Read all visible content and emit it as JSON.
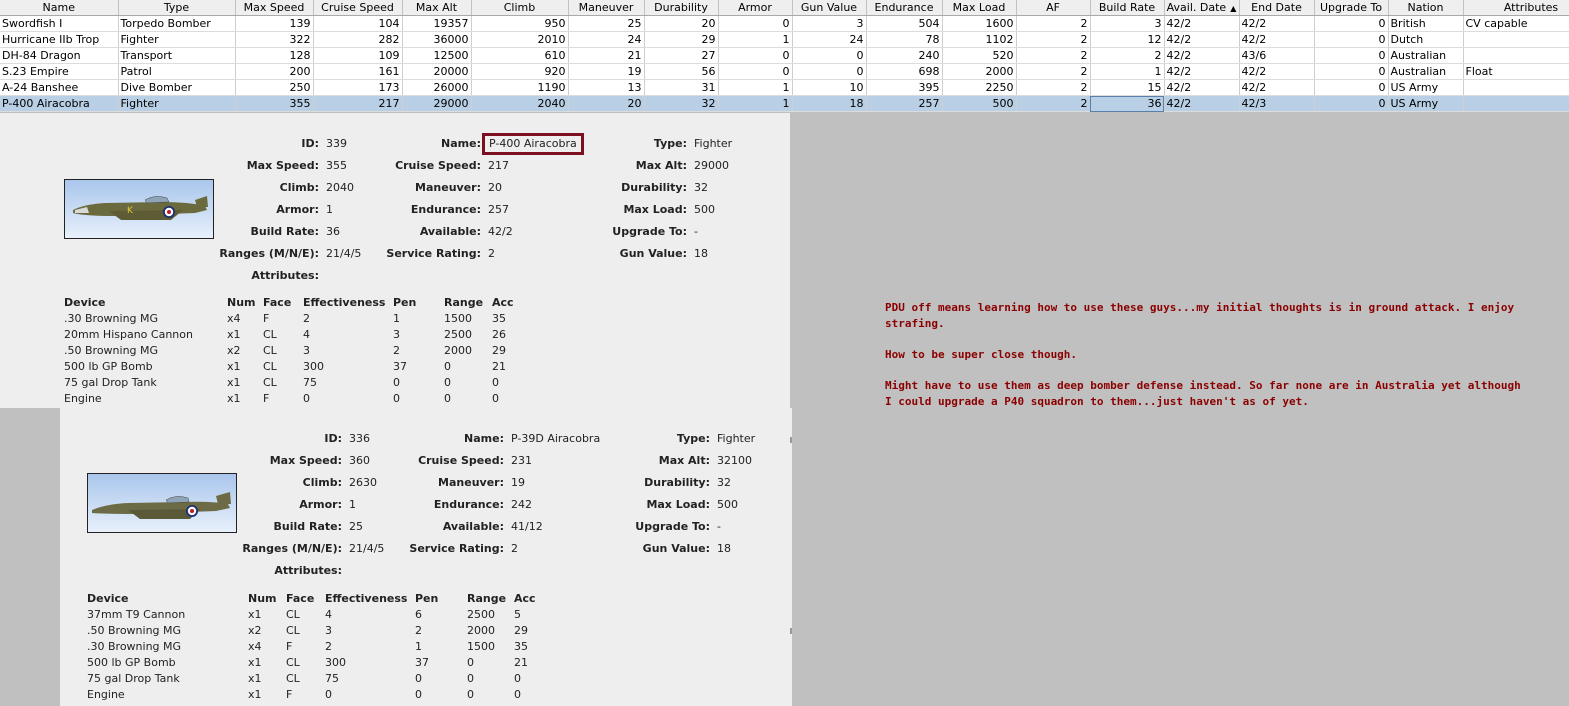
{
  "table": {
    "columns": [
      "Name",
      "Type",
      "Max Speed",
      "Cruise Speed",
      "Max Alt",
      "Climb",
      "Maneuver",
      "Durability",
      "Armor",
      "Gun Value",
      "Endurance",
      "Max Load",
      "AF",
      "Build Rate",
      "Avail. Date",
      "End Date",
      "Upgrade To",
      "Nation",
      "Attributes"
    ],
    "sorted_column": "Avail. Date",
    "sort_icon": "sort-ascending-icon",
    "rows": [
      [
        "Swordfish I",
        "Torpedo Bomber",
        "139",
        "104",
        "19357",
        "950",
        "25",
        "20",
        "0",
        "3",
        "504",
        "1600",
        "2",
        "3",
        "42/2",
        "42/2",
        "0",
        "British",
        "CV capable"
      ],
      [
        "Hurricane IIb Trop",
        "Fighter",
        "322",
        "282",
        "36000",
        "2010",
        "24",
        "29",
        "1",
        "24",
        "78",
        "1102",
        "2",
        "12",
        "42/2",
        "42/2",
        "0",
        "Dutch",
        ""
      ],
      [
        "DH-84 Dragon",
        "Transport",
        "128",
        "109",
        "12500",
        "610",
        "21",
        "27",
        "0",
        "0",
        "240",
        "520",
        "2",
        "2",
        "42/2",
        "43/6",
        "0",
        "Australian",
        ""
      ],
      [
        "S.23 Empire",
        "Patrol",
        "200",
        "161",
        "20000",
        "920",
        "19",
        "56",
        "0",
        "0",
        "698",
        "2000",
        "2",
        "1",
        "42/2",
        "42/2",
        "0",
        "Australian",
        "Float"
      ],
      [
        "A-24 Banshee",
        "Dive Bomber",
        "250",
        "173",
        "26000",
        "1190",
        "13",
        "31",
        "1",
        "10",
        "395",
        "2250",
        "2",
        "15",
        "42/2",
        "42/2",
        "0",
        "US Army",
        ""
      ],
      [
        "P-400 Airacobra",
        "Fighter",
        "355",
        "217",
        "29000",
        "2040",
        "20",
        "32",
        "1",
        "18",
        "257",
        "500",
        "2",
        "36",
        "42/2",
        "42/3",
        "0",
        "US Army",
        ""
      ]
    ],
    "selected_row": 5
  },
  "aircraft": [
    {
      "labels": {
        "id": "ID:",
        "name": "Name:",
        "type": "Type:",
        "max_speed": "Max Speed:",
        "cruise_speed": "Cruise Speed:",
        "max_alt": "Max Alt:",
        "climb": "Climb:",
        "maneuver": "Maneuver:",
        "durability": "Durability:",
        "armor": "Armor:",
        "endurance": "Endurance:",
        "max_load": "Max Load:",
        "build_rate": "Build Rate:",
        "available": "Available:",
        "upgrade_to": "Upgrade To:",
        "ranges": "Ranges (M/N/E):",
        "service_rating": "Service Rating:",
        "gun_value": "Gun Value:",
        "attributes": "Attributes:"
      },
      "values": {
        "id": "339",
        "name": "P-400 Airacobra",
        "type": "Fighter",
        "max_speed": "355",
        "cruise_speed": "217",
        "max_alt": "29000",
        "climb": "2040",
        "maneuver": "20",
        "durability": "32",
        "armor": "1",
        "endurance": "257",
        "max_load": "500",
        "build_rate": "36",
        "available": "42/2",
        "upgrade_to": "-",
        "ranges": "21/4/5",
        "service_rating": "2",
        "gun_value": "18",
        "attributes": ""
      },
      "device_headers": [
        "Device",
        "Num",
        "Face",
        "Effectiveness",
        "Pen",
        "Range",
        "Acc"
      ],
      "devices": [
        [
          ".30 Browning MG",
          "x4",
          "F",
          "2",
          "1",
          "1500",
          "35"
        ],
        [
          "20mm Hispano Cannon",
          "x1",
          "CL",
          "4",
          "3",
          "2500",
          "26"
        ],
        [
          ".50 Browning MG",
          "x2",
          "CL",
          "3",
          "2",
          "2000",
          "29"
        ],
        [
          "500 lb GP Bomb",
          "x1",
          "CL",
          "300",
          "37",
          "0",
          "21"
        ],
        [
          "75 gal Drop Tank",
          "x1",
          "CL",
          "75",
          "0",
          "0",
          "0"
        ],
        [
          "Engine",
          "x1",
          "F",
          "0",
          "0",
          "0",
          "0"
        ]
      ]
    },
    {
      "labels": {
        "id": "ID:",
        "name": "Name:",
        "type": "Type:",
        "max_speed": "Max Speed:",
        "cruise_speed": "Cruise Speed:",
        "max_alt": "Max Alt:",
        "climb": "Climb:",
        "maneuver": "Maneuver:",
        "durability": "Durability:",
        "armor": "Armor:",
        "endurance": "Endurance:",
        "max_load": "Max Load:",
        "build_rate": "Build Rate:",
        "available": "Available:",
        "upgrade_to": "Upgrade To:",
        "ranges": "Ranges (M/N/E):",
        "service_rating": "Service Rating:",
        "gun_value": "Gun Value:",
        "attributes": "Attributes:"
      },
      "values": {
        "id": "336",
        "name": "P-39D Airacobra",
        "type": "Fighter",
        "max_speed": "360",
        "cruise_speed": "231",
        "max_alt": "32100",
        "climb": "2630",
        "maneuver": "19",
        "durability": "32",
        "armor": "1",
        "endurance": "242",
        "max_load": "500",
        "build_rate": "25",
        "available": "41/12",
        "upgrade_to": "-",
        "ranges": "21/4/5",
        "service_rating": "2",
        "gun_value": "18",
        "attributes": ""
      },
      "device_headers": [
        "Device",
        "Num",
        "Face",
        "Effectiveness",
        "Pen",
        "Range",
        "Acc"
      ],
      "devices": [
        [
          "37mm T9 Cannon",
          "x1",
          "CL",
          "4",
          "6",
          "2500",
          "5"
        ],
        [
          ".50 Browning MG",
          "x2",
          "CL",
          "3",
          "2",
          "2000",
          "29"
        ],
        [
          ".30 Browning MG",
          "x4",
          "F",
          "2",
          "1",
          "1500",
          "35"
        ],
        [
          "500 lb GP Bomb",
          "x1",
          "CL",
          "300",
          "37",
          "0",
          "21"
        ],
        [
          "75 gal Drop Tank",
          "x1",
          "CL",
          "75",
          "0",
          "0",
          "0"
        ],
        [
          "Engine",
          "x1",
          "F",
          "0",
          "0",
          "0",
          "0"
        ]
      ]
    }
  ],
  "notes": [
    "PDU off means learning how to use these guys...my initial thoughts is in ground attack.  I enjoy strafing.",
    "How to be super close though.",
    "Might have to use them as deep bomber defense instead.  So far none are in Australia yet although I could upgrade a P40 squadron to them...just haven't as of yet."
  ],
  "colors": {
    "selection": "#b8cfe5",
    "highlight_box": "#7d1020",
    "notes_text": "#8b0000",
    "panel_bg": "#eeeeee",
    "desktop_bg": "#c0c0c0"
  }
}
